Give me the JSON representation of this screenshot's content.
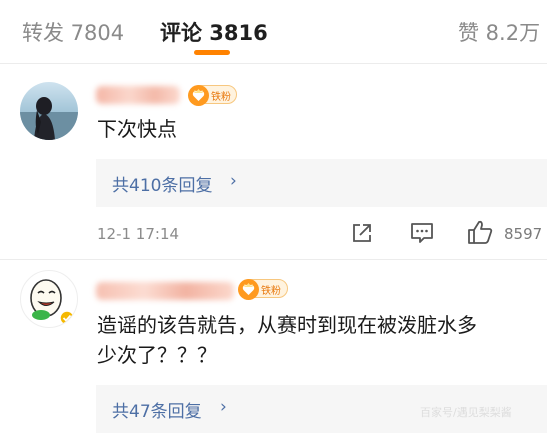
{
  "tabs": {
    "repost": "转发 7804",
    "comments": "评论 3816",
    "likes": "赞 8.2万"
  },
  "accent_color": "#ff8200",
  "link_color": "#4d6fa5",
  "comments": [
    {
      "badge": "铁粉",
      "text": "下次快点",
      "replies": "共410条回复",
      "timestamp": "12-1 17:14",
      "like_count": "8597",
      "icons": [
        "share-icon",
        "comment-icon",
        "like-icon"
      ]
    },
    {
      "badge": "铁粉",
      "text_line1": "造谣的该告就告，从赛时到现在被泼脏水多",
      "text_line2": "少次了？？？",
      "replies": "共47条回复"
    }
  ],
  "chevron": "›",
  "watermark": "百家号/遇见梨梨酱"
}
